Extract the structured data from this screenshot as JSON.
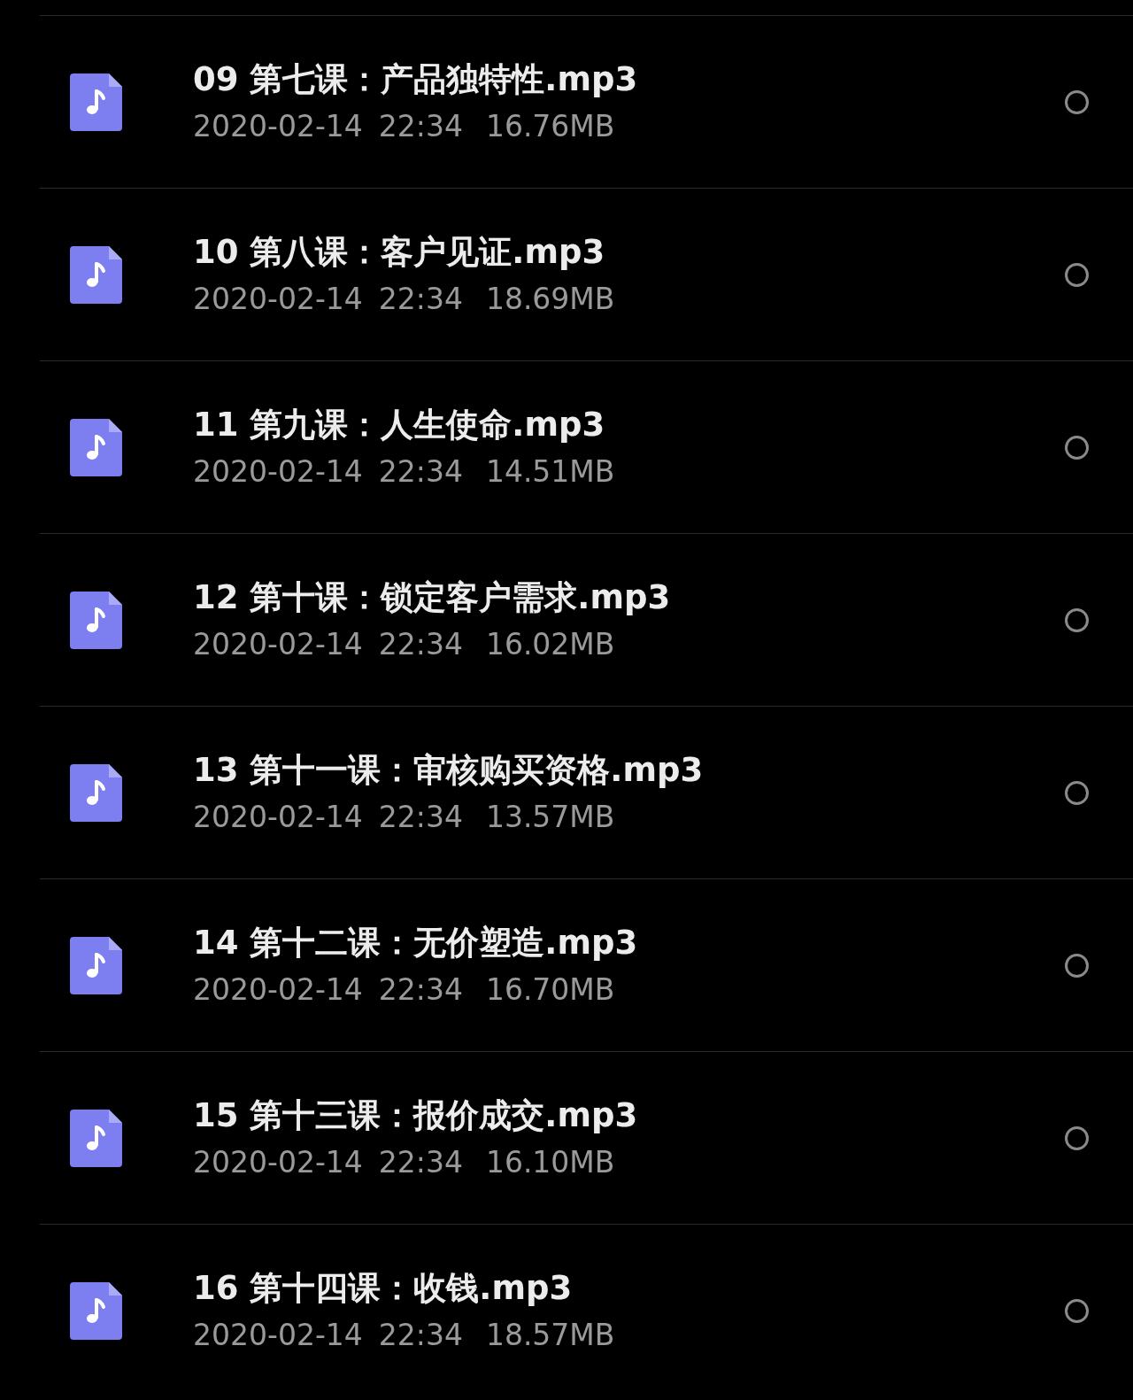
{
  "files": [
    {
      "name": "09 第七课：产品独特性.mp3",
      "date": "2020-02-14",
      "time": "22:34",
      "size": "16.76MB",
      "selected": false
    },
    {
      "name": "10 第八课：客户见证.mp3",
      "date": "2020-02-14",
      "time": "22:34",
      "size": "18.69MB",
      "selected": false
    },
    {
      "name": "11 第九课：人生使命.mp3",
      "date": "2020-02-14",
      "time": "22:34",
      "size": "14.51MB",
      "selected": false
    },
    {
      "name": "12 第十课：锁定客户需求.mp3",
      "date": "2020-02-14",
      "time": "22:34",
      "size": "16.02MB",
      "selected": false
    },
    {
      "name": "13 第十一课：审核购买资格.mp3",
      "date": "2020-02-14",
      "time": "22:34",
      "size": "13.57MB",
      "selected": false
    },
    {
      "name": "14 第十二课：无价塑造.mp3",
      "date": "2020-02-14",
      "time": "22:34",
      "size": "16.70MB",
      "selected": false
    },
    {
      "name": "15 第十三课：报价成交.mp3",
      "date": "2020-02-14",
      "time": "22:34",
      "size": "16.10MB",
      "selected": false
    },
    {
      "name": "16 第十四课：收钱.mp3",
      "date": "2020-02-14",
      "time": "22:34",
      "size": "18.57MB",
      "selected": false
    }
  ]
}
